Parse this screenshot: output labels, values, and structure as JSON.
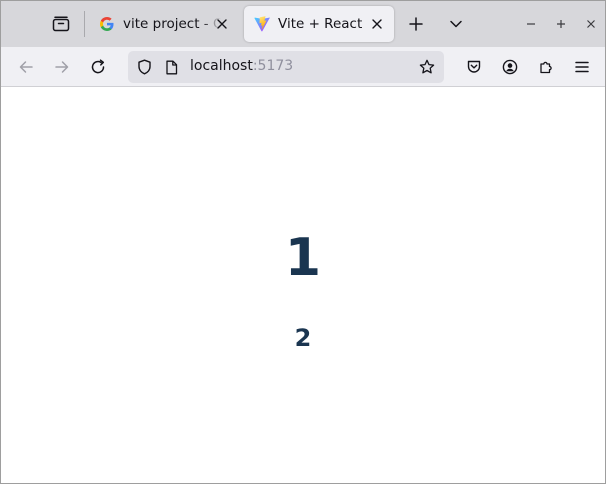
{
  "browser": {
    "tabs": [
      {
        "title": "vite project - Google Search",
        "favicon": "google-g-icon",
        "active": false
      },
      {
        "title": "Vite + React",
        "favicon": "vite-logo-icon",
        "active": true
      }
    ],
    "url": {
      "host": "localhost",
      "port": ":5173"
    },
    "accent": "#15141a"
  },
  "page": {
    "heading1": "1",
    "heading2": "2",
    "text_color": "#1a3550"
  }
}
